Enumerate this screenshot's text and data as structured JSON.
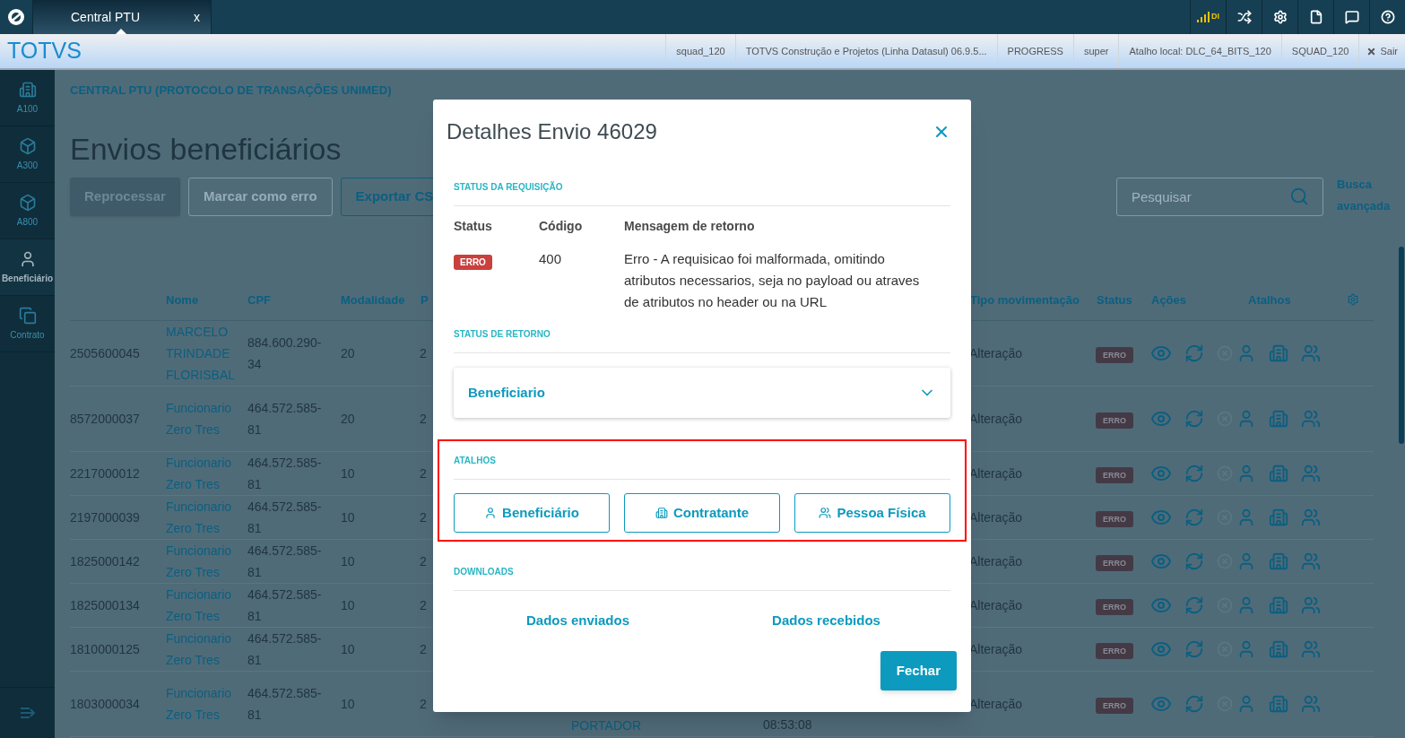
{
  "top_bar": {
    "tab": {
      "label": "Central PTU",
      "close": "x",
      "selected": true
    },
    "signal_label": "DI"
  },
  "header": {
    "brand": "TOTVS",
    "info": [
      "squad_120",
      "TOTVS Construção e Projetos (Linha Datasul) 06.9.5...",
      "PROGRESS",
      "super",
      "Atalho local: DLC_64_BITS_120",
      "SQUAD_120"
    ],
    "logout": "Sair"
  },
  "sidebar": {
    "items": [
      {
        "label": "A100",
        "kind": "building",
        "selected": false
      },
      {
        "label": "A300",
        "kind": "box",
        "selected": false
      },
      {
        "label": "A800",
        "kind": "box",
        "selected": false
      },
      {
        "label": "Beneficiário",
        "kind": "person",
        "selected": true
      },
      {
        "label": "Contrato",
        "kind": "copy",
        "selected": false
      }
    ]
  },
  "page": {
    "breadcrumb": "CENTRAL PTU (PROTOCOLO DE TRANSAÇÕES UNIMED)",
    "title": "Envios beneficiários",
    "actions": [
      {
        "label": "Reprocessar",
        "kind": "primary",
        "disabled": true
      },
      {
        "label": "Marcar como erro",
        "kind": "outline",
        "disabled": true
      },
      {
        "label": "Exportar CS",
        "kind": "outline",
        "disabled": false
      }
    ],
    "search": {
      "placeholder": "Pesquisar"
    },
    "advanced_search": "Busca avançada"
  },
  "table": {
    "columns": [
      "Nome",
      "CPF",
      "Modalidade",
      "P",
      "Tipo movimentação",
      "Status",
      "Ações",
      "Atalhos"
    ],
    "rows": [
      {
        "column_1": "2505600045",
        "nome": "MARCELO TRINDADE FLORISBAL",
        "cpf": "884.600.290-34",
        "modalidade": "20",
        "column_5": "2",
        "tipo_movimentacao": "Alteração",
        "status": "ERRO"
      },
      {
        "column_1": "8572000037",
        "nome": "Funcionario Zero Tres",
        "cpf": "464.572.585-81",
        "modalidade": "20",
        "column_5": "2",
        "tipo_movimentacao": "Alteração",
        "status": "ERRO"
      },
      {
        "column_1": "2217000012",
        "nome": "Funcionario Zero Tres",
        "cpf": "464.572.585-81",
        "modalidade": "10",
        "column_5": "2",
        "tipo_movimentacao": "Alteração",
        "status": "ERRO"
      },
      {
        "column_1": "2197000039",
        "nome": "Funcionario Zero Tres",
        "cpf": "464.572.585-81",
        "modalidade": "10",
        "column_5": "2",
        "tipo_movimentacao": "Alteração",
        "status": "ERRO"
      },
      {
        "column_1": "1825000142",
        "nome": "Funcionario Zero Tres",
        "cpf": "464.572.585-81",
        "modalidade": "10",
        "column_5": "2",
        "tipo_movimentacao": "Alteração",
        "status": "ERRO"
      },
      {
        "column_1": "1825000134",
        "nome": "Funcionario Zero Tres",
        "cpf": "464.572.585-81",
        "modalidade": "10",
        "column_5": "2",
        "tipo_movimentacao": "Alteração",
        "status": "ERRO"
      },
      {
        "column_1": "1810000125",
        "nome": "Funcionario Zero Tres",
        "cpf": "464.572.585-81",
        "modalidade": "10",
        "column_5": "2",
        "tipo_movimentacao": "Alteração",
        "status": "ERRO"
      },
      {
        "column_1": "1803000034",
        "nome": "Funcionario Zero Tres",
        "cpf": "464.572.585-81",
        "modalidade": "10",
        "column_5": "2",
        "column_6": "PORTADOR",
        "column_7": "08:53:08",
        "tipo_movimentacao": "Alteração",
        "status": "ERRO"
      }
    ]
  },
  "modal": {
    "title": "Detalhes Envio 46029",
    "request_section": {
      "heading": "STATUS DA REQUISIÇÃO",
      "labels": [
        "Status",
        "Código",
        "Mensagem de retorno"
      ],
      "status": "ERRO",
      "code": "400",
      "message": "Erro - A requisicao foi malformada, omitindo atributos necessarios, seja no payload ou atraves de atributos no header ou na URL"
    },
    "return_section": {
      "heading": "STATUS DE RETORNO",
      "accordion": {
        "label": "Beneficiario",
        "expanded": false
      }
    },
    "shortcuts": {
      "heading": "ATALHOS",
      "buttons": [
        {
          "label": "Beneficiário",
          "kind": "person"
        },
        {
          "label": "Contratante",
          "kind": "building"
        },
        {
          "label": "Pessoa Física",
          "kind": "people"
        }
      ]
    },
    "downloads": {
      "heading": "DOWNLOADS",
      "links": [
        "Dados enviados",
        "Dados recebidos"
      ]
    },
    "close_button": "Fechar"
  }
}
